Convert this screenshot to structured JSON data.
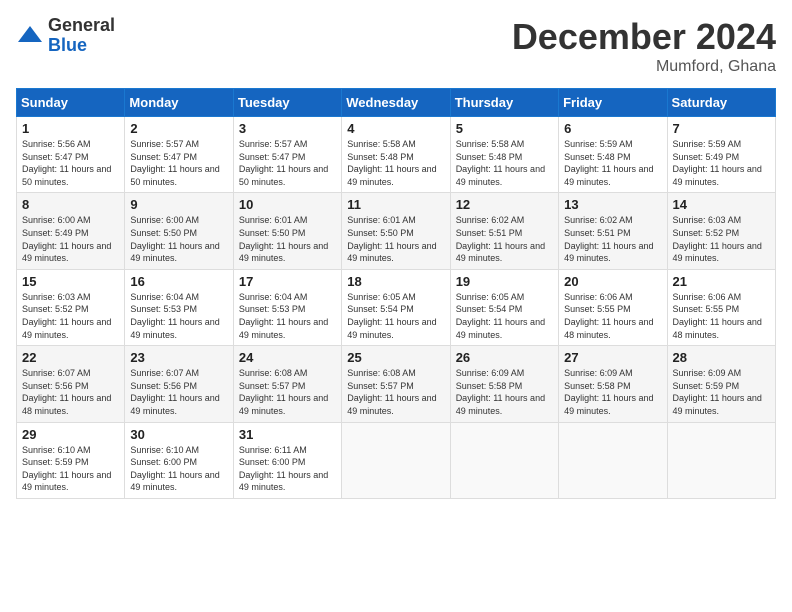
{
  "logo": {
    "general": "General",
    "blue": "Blue"
  },
  "header": {
    "month": "December 2024",
    "location": "Mumford, Ghana"
  },
  "weekdays": [
    "Sunday",
    "Monday",
    "Tuesday",
    "Wednesday",
    "Thursday",
    "Friday",
    "Saturday"
  ],
  "weeks": [
    [
      {
        "day": 1,
        "sunrise": "5:56 AM",
        "sunset": "5:47 PM",
        "daylight": "11 hours and 50 minutes."
      },
      {
        "day": 2,
        "sunrise": "5:57 AM",
        "sunset": "5:47 PM",
        "daylight": "11 hours and 50 minutes."
      },
      {
        "day": 3,
        "sunrise": "5:57 AM",
        "sunset": "5:47 PM",
        "daylight": "11 hours and 50 minutes."
      },
      {
        "day": 4,
        "sunrise": "5:58 AM",
        "sunset": "5:48 PM",
        "daylight": "11 hours and 49 minutes."
      },
      {
        "day": 5,
        "sunrise": "5:58 AM",
        "sunset": "5:48 PM",
        "daylight": "11 hours and 49 minutes."
      },
      {
        "day": 6,
        "sunrise": "5:59 AM",
        "sunset": "5:48 PM",
        "daylight": "11 hours and 49 minutes."
      },
      {
        "day": 7,
        "sunrise": "5:59 AM",
        "sunset": "5:49 PM",
        "daylight": "11 hours and 49 minutes."
      }
    ],
    [
      {
        "day": 8,
        "sunrise": "6:00 AM",
        "sunset": "5:49 PM",
        "daylight": "11 hours and 49 minutes."
      },
      {
        "day": 9,
        "sunrise": "6:00 AM",
        "sunset": "5:50 PM",
        "daylight": "11 hours and 49 minutes."
      },
      {
        "day": 10,
        "sunrise": "6:01 AM",
        "sunset": "5:50 PM",
        "daylight": "11 hours and 49 minutes."
      },
      {
        "day": 11,
        "sunrise": "6:01 AM",
        "sunset": "5:50 PM",
        "daylight": "11 hours and 49 minutes."
      },
      {
        "day": 12,
        "sunrise": "6:02 AM",
        "sunset": "5:51 PM",
        "daylight": "11 hours and 49 minutes."
      },
      {
        "day": 13,
        "sunrise": "6:02 AM",
        "sunset": "5:51 PM",
        "daylight": "11 hours and 49 minutes."
      },
      {
        "day": 14,
        "sunrise": "6:03 AM",
        "sunset": "5:52 PM",
        "daylight": "11 hours and 49 minutes."
      }
    ],
    [
      {
        "day": 15,
        "sunrise": "6:03 AM",
        "sunset": "5:52 PM",
        "daylight": "11 hours and 49 minutes."
      },
      {
        "day": 16,
        "sunrise": "6:04 AM",
        "sunset": "5:53 PM",
        "daylight": "11 hours and 49 minutes."
      },
      {
        "day": 17,
        "sunrise": "6:04 AM",
        "sunset": "5:53 PM",
        "daylight": "11 hours and 49 minutes."
      },
      {
        "day": 18,
        "sunrise": "6:05 AM",
        "sunset": "5:54 PM",
        "daylight": "11 hours and 49 minutes."
      },
      {
        "day": 19,
        "sunrise": "6:05 AM",
        "sunset": "5:54 PM",
        "daylight": "11 hours and 49 minutes."
      },
      {
        "day": 20,
        "sunrise": "6:06 AM",
        "sunset": "5:55 PM",
        "daylight": "11 hours and 48 minutes."
      },
      {
        "day": 21,
        "sunrise": "6:06 AM",
        "sunset": "5:55 PM",
        "daylight": "11 hours and 48 minutes."
      }
    ],
    [
      {
        "day": 22,
        "sunrise": "6:07 AM",
        "sunset": "5:56 PM",
        "daylight": "11 hours and 48 minutes."
      },
      {
        "day": 23,
        "sunrise": "6:07 AM",
        "sunset": "5:56 PM",
        "daylight": "11 hours and 49 minutes."
      },
      {
        "day": 24,
        "sunrise": "6:08 AM",
        "sunset": "5:57 PM",
        "daylight": "11 hours and 49 minutes."
      },
      {
        "day": 25,
        "sunrise": "6:08 AM",
        "sunset": "5:57 PM",
        "daylight": "11 hours and 49 minutes."
      },
      {
        "day": 26,
        "sunrise": "6:09 AM",
        "sunset": "5:58 PM",
        "daylight": "11 hours and 49 minutes."
      },
      {
        "day": 27,
        "sunrise": "6:09 AM",
        "sunset": "5:58 PM",
        "daylight": "11 hours and 49 minutes."
      },
      {
        "day": 28,
        "sunrise": "6:09 AM",
        "sunset": "5:59 PM",
        "daylight": "11 hours and 49 minutes."
      }
    ],
    [
      {
        "day": 29,
        "sunrise": "6:10 AM",
        "sunset": "5:59 PM",
        "daylight": "11 hours and 49 minutes."
      },
      {
        "day": 30,
        "sunrise": "6:10 AM",
        "sunset": "6:00 PM",
        "daylight": "11 hours and 49 minutes."
      },
      {
        "day": 31,
        "sunrise": "6:11 AM",
        "sunset": "6:00 PM",
        "daylight": "11 hours and 49 minutes."
      },
      null,
      null,
      null,
      null
    ]
  ]
}
